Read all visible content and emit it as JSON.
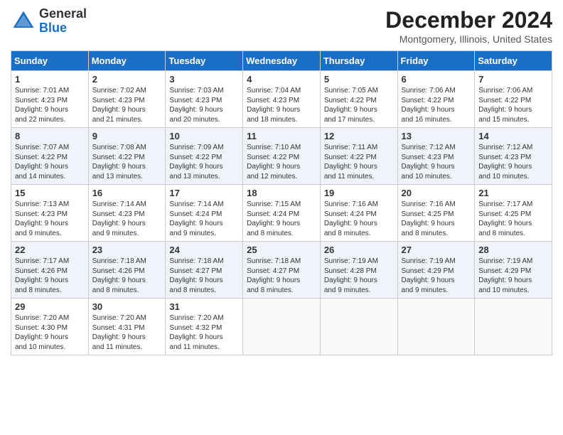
{
  "header": {
    "logo_general": "General",
    "logo_blue": "Blue",
    "title": "December 2024",
    "location": "Montgomery, Illinois, United States"
  },
  "columns": [
    "Sunday",
    "Monday",
    "Tuesday",
    "Wednesday",
    "Thursday",
    "Friday",
    "Saturday"
  ],
  "weeks": [
    [
      {
        "day": "1",
        "lines": [
          "Sunrise: 7:01 AM",
          "Sunset: 4:23 PM",
          "Daylight: 9 hours",
          "and 22 minutes."
        ]
      },
      {
        "day": "2",
        "lines": [
          "Sunrise: 7:02 AM",
          "Sunset: 4:23 PM",
          "Daylight: 9 hours",
          "and 21 minutes."
        ]
      },
      {
        "day": "3",
        "lines": [
          "Sunrise: 7:03 AM",
          "Sunset: 4:23 PM",
          "Daylight: 9 hours",
          "and 20 minutes."
        ]
      },
      {
        "day": "4",
        "lines": [
          "Sunrise: 7:04 AM",
          "Sunset: 4:23 PM",
          "Daylight: 9 hours",
          "and 18 minutes."
        ]
      },
      {
        "day": "5",
        "lines": [
          "Sunrise: 7:05 AM",
          "Sunset: 4:22 PM",
          "Daylight: 9 hours",
          "and 17 minutes."
        ]
      },
      {
        "day": "6",
        "lines": [
          "Sunrise: 7:06 AM",
          "Sunset: 4:22 PM",
          "Daylight: 9 hours",
          "and 16 minutes."
        ]
      },
      {
        "day": "7",
        "lines": [
          "Sunrise: 7:06 AM",
          "Sunset: 4:22 PM",
          "Daylight: 9 hours",
          "and 15 minutes."
        ]
      }
    ],
    [
      {
        "day": "8",
        "lines": [
          "Sunrise: 7:07 AM",
          "Sunset: 4:22 PM",
          "Daylight: 9 hours",
          "and 14 minutes."
        ]
      },
      {
        "day": "9",
        "lines": [
          "Sunrise: 7:08 AM",
          "Sunset: 4:22 PM",
          "Daylight: 9 hours",
          "and 13 minutes."
        ]
      },
      {
        "day": "10",
        "lines": [
          "Sunrise: 7:09 AM",
          "Sunset: 4:22 PM",
          "Daylight: 9 hours",
          "and 13 minutes."
        ]
      },
      {
        "day": "11",
        "lines": [
          "Sunrise: 7:10 AM",
          "Sunset: 4:22 PM",
          "Daylight: 9 hours",
          "and 12 minutes."
        ]
      },
      {
        "day": "12",
        "lines": [
          "Sunrise: 7:11 AM",
          "Sunset: 4:22 PM",
          "Daylight: 9 hours",
          "and 11 minutes."
        ]
      },
      {
        "day": "13",
        "lines": [
          "Sunrise: 7:12 AM",
          "Sunset: 4:23 PM",
          "Daylight: 9 hours",
          "and 10 minutes."
        ]
      },
      {
        "day": "14",
        "lines": [
          "Sunrise: 7:12 AM",
          "Sunset: 4:23 PM",
          "Daylight: 9 hours",
          "and 10 minutes."
        ]
      }
    ],
    [
      {
        "day": "15",
        "lines": [
          "Sunrise: 7:13 AM",
          "Sunset: 4:23 PM",
          "Daylight: 9 hours",
          "and 9 minutes."
        ]
      },
      {
        "day": "16",
        "lines": [
          "Sunrise: 7:14 AM",
          "Sunset: 4:23 PM",
          "Daylight: 9 hours",
          "and 9 minutes."
        ]
      },
      {
        "day": "17",
        "lines": [
          "Sunrise: 7:14 AM",
          "Sunset: 4:24 PM",
          "Daylight: 9 hours",
          "and 9 minutes."
        ]
      },
      {
        "day": "18",
        "lines": [
          "Sunrise: 7:15 AM",
          "Sunset: 4:24 PM",
          "Daylight: 9 hours",
          "and 8 minutes."
        ]
      },
      {
        "day": "19",
        "lines": [
          "Sunrise: 7:16 AM",
          "Sunset: 4:24 PM",
          "Daylight: 9 hours",
          "and 8 minutes."
        ]
      },
      {
        "day": "20",
        "lines": [
          "Sunrise: 7:16 AM",
          "Sunset: 4:25 PM",
          "Daylight: 9 hours",
          "and 8 minutes."
        ]
      },
      {
        "day": "21",
        "lines": [
          "Sunrise: 7:17 AM",
          "Sunset: 4:25 PM",
          "Daylight: 9 hours",
          "and 8 minutes."
        ]
      }
    ],
    [
      {
        "day": "22",
        "lines": [
          "Sunrise: 7:17 AM",
          "Sunset: 4:26 PM",
          "Daylight: 9 hours",
          "and 8 minutes."
        ]
      },
      {
        "day": "23",
        "lines": [
          "Sunrise: 7:18 AM",
          "Sunset: 4:26 PM",
          "Daylight: 9 hours",
          "and 8 minutes."
        ]
      },
      {
        "day": "24",
        "lines": [
          "Sunrise: 7:18 AM",
          "Sunset: 4:27 PM",
          "Daylight: 9 hours",
          "and 8 minutes."
        ]
      },
      {
        "day": "25",
        "lines": [
          "Sunrise: 7:18 AM",
          "Sunset: 4:27 PM",
          "Daylight: 9 hours",
          "and 8 minutes."
        ]
      },
      {
        "day": "26",
        "lines": [
          "Sunrise: 7:19 AM",
          "Sunset: 4:28 PM",
          "Daylight: 9 hours",
          "and 9 minutes."
        ]
      },
      {
        "day": "27",
        "lines": [
          "Sunrise: 7:19 AM",
          "Sunset: 4:29 PM",
          "Daylight: 9 hours",
          "and 9 minutes."
        ]
      },
      {
        "day": "28",
        "lines": [
          "Sunrise: 7:19 AM",
          "Sunset: 4:29 PM",
          "Daylight: 9 hours",
          "and 10 minutes."
        ]
      }
    ],
    [
      {
        "day": "29",
        "lines": [
          "Sunrise: 7:20 AM",
          "Sunset: 4:30 PM",
          "Daylight: 9 hours",
          "and 10 minutes."
        ]
      },
      {
        "day": "30",
        "lines": [
          "Sunrise: 7:20 AM",
          "Sunset: 4:31 PM",
          "Daylight: 9 hours",
          "and 11 minutes."
        ]
      },
      {
        "day": "31",
        "lines": [
          "Sunrise: 7:20 AM",
          "Sunset: 4:32 PM",
          "Daylight: 9 hours",
          "and 11 minutes."
        ]
      },
      null,
      null,
      null,
      null
    ]
  ]
}
